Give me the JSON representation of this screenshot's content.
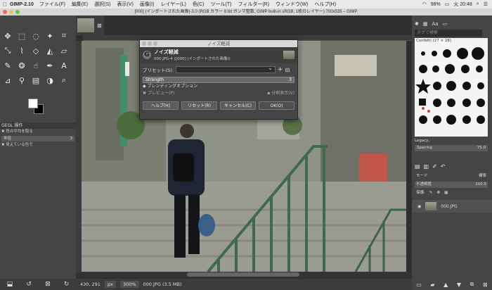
{
  "menubar": {
    "app": "GIMP-2.10",
    "items": [
      "ファイル(F)",
      "編集(E)",
      "選択(S)",
      "表示(V)",
      "画像(I)",
      "レイヤー(L)",
      "色(C)",
      "ツール(T)",
      "フィルター(R)",
      "ウィンドウ(W)",
      "ヘルプ(H)"
    ],
    "battery": "98%",
    "clock": "火 20:48"
  },
  "window": {
    "title": "[000] (インポートされた画像)-3.0 (RGB カラー 8 bit ガンマ整数, GIMP built-in sRGB, 1枚のレイヤー) 700x535 – GIMP"
  },
  "left_panel": {
    "gegl_title": "GEGL 操作",
    "opt1": "色の平均を取る",
    "field_label": "半径",
    "field_value": "3",
    "opt2": "見えている色で"
  },
  "dialog": {
    "title": "ノイズ軽減",
    "header_title": "ノイズ軽減",
    "header_sub": "000.JPG-4 ([000] (インポートされた画像))",
    "preset_label": "プリセット(S):",
    "strength_label": "Strength",
    "strength_value": "3",
    "blend_label": "ブレンディングオプション",
    "preview_label": "プレビュー(P)",
    "split_label": "分割表示(V)",
    "buttons": {
      "help": "ヘルプ(H)",
      "reset": "リセット(R)",
      "cancel": "キャンセル(C)",
      "ok": "OK(O)"
    }
  },
  "status": {
    "coords": "430, 291",
    "unit": "px",
    "zoom": "300%",
    "file": "000.JPG (3.5 MB)"
  },
  "right_panel": {
    "filter_placeholder": "タグで検索",
    "brush_label": "Confetti (27 × 28)",
    "legacy": "Legacy,",
    "spacing_label": "Spacing",
    "spacing_value": "75.0",
    "mode_label": "モード",
    "mode_value": "標準",
    "opacity_label": "不透明度",
    "opacity_value": "100.0",
    "lock_label": "保護:",
    "layer_name": "000.JPG"
  }
}
